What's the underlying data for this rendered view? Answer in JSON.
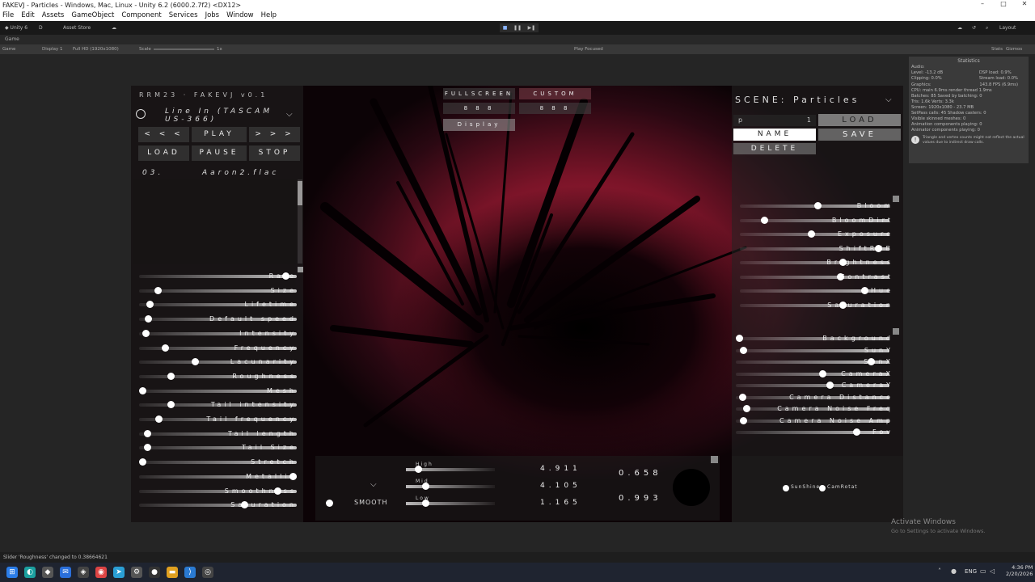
{
  "window": {
    "title": "FAKEVJ - Particles - Windows, Mac, Linux - Unity 6.2 (6000.2.7f2) <DX12>",
    "controls": [
      "–",
      "□",
      "✕"
    ]
  },
  "menu": [
    "File",
    "Edit",
    "Assets",
    "GameObject",
    "Component",
    "Services",
    "Jobs",
    "Window",
    "Help"
  ],
  "toolbar": {
    "account": "Unity 6",
    "user": "D",
    "asset_store": "Asset Store",
    "layout": "Layout"
  },
  "game_tab": {
    "label": "Game"
  },
  "game_bar": {
    "view": "Game",
    "display": "Display 1",
    "resolution": "Full HD (1920x1080)",
    "scale_label": "Scale",
    "scale_value": "1x",
    "play_mode": "Play Focused",
    "stats": "Stats",
    "gizmos": "Gizmos"
  },
  "app": {
    "version": "RRM23 · FAKEVJ v0.1",
    "input_device": "Line In (TASCAM US-366)",
    "transport": {
      "prev": "< < <",
      "play": "PLAY",
      "next": "> > >",
      "load": "LOAD",
      "pause": "PAUSE",
      "stop": "STOP"
    },
    "track_index": "03.",
    "track_name": "Aaron2.flac",
    "fullscreen": "FULLSCREEN",
    "custom": "CUSTOM",
    "res_a": "8   8   8",
    "res_b": "8   8   8",
    "display": "Display",
    "scene_title": "SCENE: Particles",
    "preset_value": "p",
    "preset_slot": "1",
    "load_button": "LOAD",
    "save_button": "SAVE",
    "name_field": "NAME",
    "delete_button": "DELETE",
    "left_sliders": [
      {
        "label": "Rate",
        "value": 0.95
      },
      {
        "label": "Size",
        "value": 0.1
      },
      {
        "label": "Lifetime",
        "value": 0.05
      },
      {
        "label": "Default speed",
        "value": 0.04
      },
      {
        "label": "Intensity",
        "value": 0.02
      },
      {
        "label": "Frequency",
        "value": 0.15
      },
      {
        "label": "Lacunarity",
        "value": 0.35
      },
      {
        "label": "Roughness",
        "value": 0.19
      },
      {
        "label": "Mesh",
        "value": 0.0
      },
      {
        "label": "Tail intensity",
        "value": 0.19
      },
      {
        "label": "Tail frequency",
        "value": 0.11
      },
      {
        "label": "Tail length",
        "value": 0.03
      },
      {
        "label": "Tail Size",
        "value": 0.03
      },
      {
        "label": "Stretch",
        "value": 0.0
      },
      {
        "label": "Metallic",
        "value": 1.0
      },
      {
        "label": "Smoothness",
        "value": 0.9
      },
      {
        "label": "Saturation",
        "value": 0.68
      }
    ],
    "right_sliders_a": [
      {
        "label": "Bloom",
        "value": 0.52
      },
      {
        "label": "BloomDirt",
        "value": 0.15
      },
      {
        "label": "Exposure",
        "value": 0.48
      },
      {
        "label": "ShiftRGB",
        "value": 0.95
      },
      {
        "label": "Brightness",
        "value": 0.7
      },
      {
        "label": "Contrast",
        "value": 0.68
      },
      {
        "label": "Hue",
        "value": 0.85
      },
      {
        "label": "Saturation",
        "value": 0.7
      }
    ],
    "right_sliders_b": [
      {
        "label": "Background",
        "value": 0.0
      },
      {
        "label": "SunY",
        "value": 0.03
      },
      {
        "label": "SunX",
        "value": 0.9
      },
      {
        "label": "CameraX",
        "value": 0.57
      },
      {
        "label": "CameraY",
        "value": 0.62
      },
      {
        "label": "Camera Distance",
        "value": 0.02
      },
      {
        "label": "Camera Noise Freq",
        "value": 0.05
      },
      {
        "label": "Camera Noise Amp",
        "value": 0.03
      },
      {
        "label": "Fov",
        "value": 0.8
      }
    ],
    "audio": {
      "smooth": "SMOOTH",
      "bands": [
        {
          "label": "High",
          "value": 0.1,
          "readout": "4.911"
        },
        {
          "label": "Mid",
          "value": 0.18,
          "readout": "4.105"
        },
        {
          "label": "Low",
          "value": 0.18,
          "readout": "1.165"
        }
      ],
      "gain_a": "0.658",
      "gain_b": "0.993",
      "toggle_a": "SunShine",
      "toggle_b": "CamRotat"
    }
  },
  "stats": {
    "title": "Statistics",
    "audio_head": "Audio:",
    "audio_lines": [
      "Level: -13.2 dB",
      "Clipping: 0.0%"
    ],
    "audio_right": [
      "DSP load: 0.9%",
      "Stream load: 0.0%"
    ],
    "graphics_head": "Graphics:",
    "fps": "143.8 FPS (6.9ms)",
    "graphics_lines": [
      "CPU: main 6.9ms  render thread 1.9ms",
      "Batches: 85   Saved by batching: 0",
      "Tris: 1.6k   Verts: 3.3k",
      "Screen: 1920x1080 - 23.7 MB",
      "SetPass calls: 45   Shadow casters: 0",
      "Visible skinned meshes: 0",
      "Animation components playing: 0",
      "Animator components playing: 0"
    ],
    "note": "Triangle and vertex counts might not reflect the actual values due to indirect draw calls."
  },
  "status_text": "Slider 'Roughness' changed to 0.38664621",
  "activate": {
    "title": "Activate Windows",
    "subtitle": "Go to Settings to activate Windows."
  },
  "taskbar": {
    "lang": "ENG",
    "time": "4:36 PM",
    "date": "2/20/2026"
  }
}
